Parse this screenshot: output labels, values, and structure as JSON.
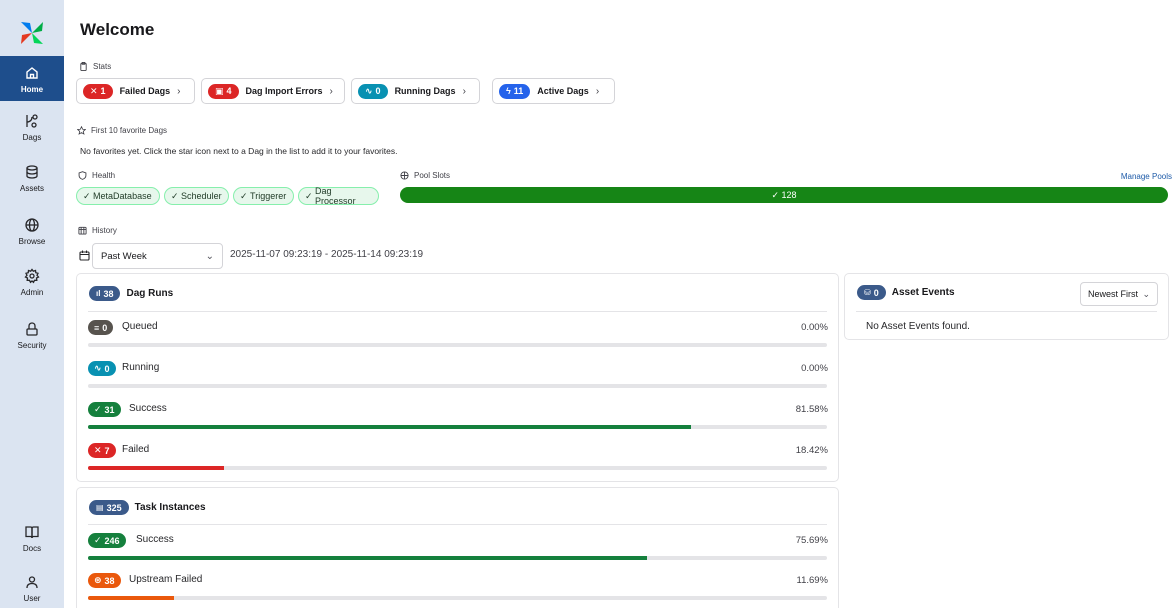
{
  "sidebar": {
    "items": [
      {
        "id": "home",
        "label": "Home",
        "icon": "home-icon"
      },
      {
        "id": "dags",
        "label": "Dags",
        "icon": "dags-icon"
      },
      {
        "id": "assets",
        "label": "Assets",
        "icon": "database-icon"
      },
      {
        "id": "browse",
        "label": "Browse",
        "icon": "globe-icon"
      },
      {
        "id": "admin",
        "label": "Admin",
        "icon": "gear-icon"
      },
      {
        "id": "security",
        "label": "Security",
        "icon": "lock-icon"
      }
    ],
    "bottom_items": [
      {
        "id": "docs",
        "label": "Docs",
        "icon": "book-icon"
      },
      {
        "id": "user",
        "label": "User",
        "icon": "user-icon"
      }
    ],
    "active": "home"
  },
  "page": {
    "title": "Welcome"
  },
  "stats": {
    "label": "Stats",
    "cards": [
      {
        "count": "1",
        "title": "Failed Dags",
        "color": "#dc2626",
        "icon": "x-icon"
      },
      {
        "count": "4",
        "title": "Dag Import Errors",
        "color": "#dc2626",
        "icon": "file-error-icon"
      },
      {
        "count": "0",
        "title": "Running Dags",
        "color": "#0891b2",
        "icon": "activity-icon"
      },
      {
        "count": "11",
        "title": "Active Dags",
        "color": "#2563eb",
        "icon": "bolt-icon"
      }
    ]
  },
  "favorites": {
    "label": "First 10 favorite Dags",
    "empty_message": "No favorites yet. Click the star icon next to a Dag in the list to add it to your favorites."
  },
  "health": {
    "label": "Health",
    "items": [
      "MetaDatabase",
      "Scheduler",
      "Triggerer",
      "Dag Processor"
    ]
  },
  "pool_slots": {
    "label": "Pool Slots",
    "value": "128",
    "manage_label": "Manage Pools"
  },
  "history": {
    "label": "History",
    "range_select": "Past Week",
    "date_range": "2025-11-07 09:23:19 - 2025-11-14 09:23:19"
  },
  "dag_runs": {
    "count": "38",
    "title": "Dag Runs",
    "rows": [
      {
        "label": "Queued",
        "count": "0",
        "percent": "0.00%",
        "fraction": 0.0,
        "color": "#57534e",
        "icon": "queue-icon"
      },
      {
        "label": "Running",
        "count": "0",
        "percent": "0.00%",
        "fraction": 0.0,
        "color": "#0891b2",
        "icon": "activity-icon"
      },
      {
        "label": "Success",
        "count": "31",
        "percent": "81.58%",
        "fraction": 0.8158,
        "color": "#15803d",
        "icon": "check-icon"
      },
      {
        "label": "Failed",
        "count": "7",
        "percent": "18.42%",
        "fraction": 0.1842,
        "color": "#dc2626",
        "icon": "x-icon"
      }
    ]
  },
  "task_instances": {
    "count": "325",
    "title": "Task Instances",
    "rows": [
      {
        "label": "Success",
        "count": "246",
        "percent": "75.69%",
        "fraction": 0.7569,
        "color": "#15803d",
        "icon": "check-icon"
      },
      {
        "label": "Upstream Failed",
        "count": "38",
        "percent": "11.69%",
        "fraction": 0.1169,
        "color": "#ea580c",
        "icon": "upstream-failed-icon"
      }
    ]
  },
  "asset_events": {
    "count": "0",
    "title": "Asset Events",
    "sort": "Newest First",
    "empty_message": "No Asset Events found."
  },
  "colors": {
    "sidebar_bg": "#dbe4f1",
    "active_nav": "#1e4e8c",
    "pool_green": "#168516",
    "badge_navy": "#3b5a8a"
  }
}
